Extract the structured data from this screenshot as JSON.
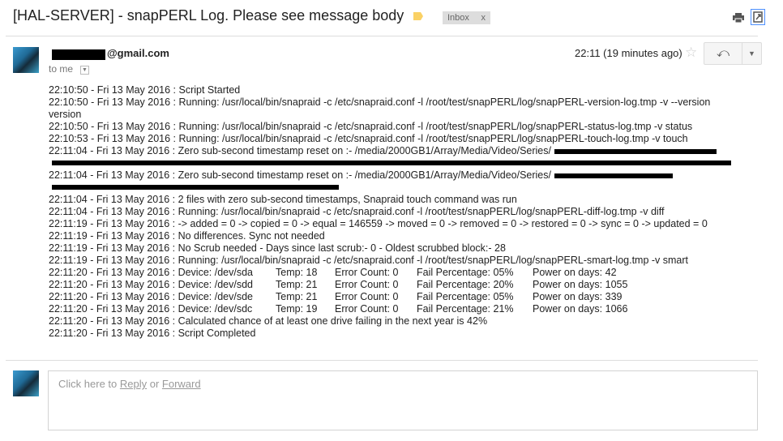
{
  "header": {
    "subject": "[HAL-SERVER] - snapPERL Log. Please see message body",
    "label": "Inbox",
    "label_remove": "x",
    "icons": [
      "label-icon",
      "print-icon",
      "popout-icon"
    ],
    "label_color": "#fad165"
  },
  "message": {
    "sender_domain": "@gmail.com",
    "to": "to me",
    "time": "22:11 (19 minutes ago)",
    "star": "☆",
    "reply": "⤺",
    "more": "▼",
    "log": [
      "22:10:50 - Fri 13 May 2016 : Script Started",
      "22:10:50 - Fri 13 May 2016 : Running: /usr/local/bin/snapraid -c /etc/snapraid.conf -l /root/test/snapPERL/log/snapPERL-version-log.tmp -v --version\nversion",
      "22:10:50 - Fri 13 May 2016 : Running: /usr/local/bin/snapraid -c /etc/snapraid.conf -l /root/test/snapPERL/log/snapPERL-status-log.tmp -v  status",
      "22:10:53 - Fri 13 May 2016 : Running: /usr/local/bin/snapraid -c /etc/snapraid.conf -l /root/test/snapPERL/log/snapPERL-touch-log.tmp -v  touch",
      "22:11:04 - Fri 13 May 2016 : Zero sub-second timestamp reset on :- /media/2000GB1/Array/Media/Video/Series/",
      "22:11:04 - Fri 13 May 2016 : Zero sub-second timestamp reset on :- /media/2000GB1/Array/Media/Video/Series/",
      "22:11:04 - Fri 13 May 2016 : 2 files with zero sub-second timestamps, Snapraid touch command was run",
      "22:11:04 - Fri 13 May 2016 : Running: /usr/local/bin/snapraid -c /etc/snapraid.conf -l /root/test/snapPERL/log/snapPERL-diff-log.tmp -v  diff",
      "22:11:19 - Fri 13 May 2016 : -> added = 0 -> copied = 0 -> equal = 146559 -> moved = 0 -> removed = 0 -> restored = 0 -> sync = 0 -> updated = 0",
      "22:11:19 - Fri 13 May 2016 : No differences. Sync not needed",
      "22:11:19 - Fri 13 May 2016 : No Scrub needed - Days since last scrub:- 0 - Oldest scrubbed block:- 28",
      "22:11:19 - Fri 13 May 2016 : Running: /usr/local/bin/snapraid -c /etc/snapraid.conf -l /root/test/snapPERL/log/snapPERL-smart-log.tmp -v  smart"
    ],
    "devices": [
      {
        "prefix": "22:11:20 - Fri 13 May 2016 : Device: /dev/sda",
        "temp": "Temp: 18",
        "errors": "Error Count: 0",
        "fail": "Fail Percentage: 05%",
        "power": "Power on days: 42"
      },
      {
        "prefix": "22:11:20 - Fri 13 May 2016 : Device: /dev/sdd",
        "temp": "Temp: 21",
        "errors": "Error Count: 0",
        "fail": "Fail Percentage: 20%",
        "power": "Power on days: 1055"
      },
      {
        "prefix": "22:11:20 - Fri 13 May 2016 : Device: /dev/sde",
        "temp": "Temp: 21",
        "errors": "Error Count: 0",
        "fail": "Fail Percentage: 05%",
        "power": "Power on days: 339"
      },
      {
        "prefix": "22:11:20 - Fri 13 May 2016 : Device: /dev/sdc",
        "temp": "Temp: 19",
        "errors": "Error Count: 0",
        "fail": "Fail Percentage: 21%",
        "power": "Power on days: 1066"
      }
    ],
    "log_end": [
      "22:11:20 - Fri 13 May 2016 : Calculated chance of at least one drive failing in the next year is 42%",
      "22:11:20 - Fri 13 May 2016 : Script Completed"
    ]
  },
  "reply_box": {
    "prefix": "Click here to ",
    "reply": "Reply",
    "or": " or ",
    "forward": "Forward"
  }
}
